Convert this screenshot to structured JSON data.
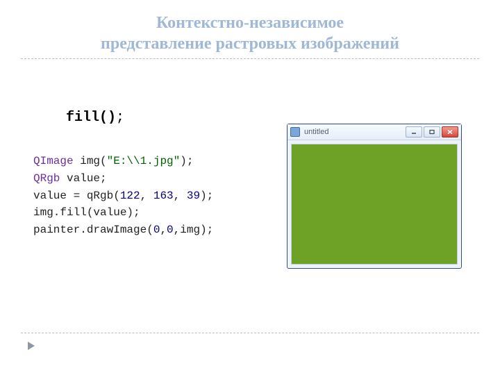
{
  "slide": {
    "title_line1": "Контекстно-независимое",
    "title_line2": "представление растровых изображений"
  },
  "method_label": {
    "name": "fill()",
    "semicolon": ";"
  },
  "code": {
    "l1_pre": "QImage",
    "l1_mid": " img(",
    "l1_str": "\"E:\\\\1.jpg\"",
    "l1_end": ");",
    "l2_pre": "QRgb",
    "l2_end": " value;",
    "l3_a": "value = qRgb(",
    "l3_n1": "122",
    "l3_s1": ", ",
    "l3_n2": "163",
    "l3_s2": ", ",
    "l3_n3": "39",
    "l3_b": ");",
    "l4": "img.fill(value);",
    "l5_a": "painter.drawImage(",
    "l5_n1": "0",
    "l5_s1": ",",
    "l5_n2": "0",
    "l5_b": ",img);"
  },
  "window": {
    "title": "untitled",
    "fill_color": "#6ea227"
  }
}
